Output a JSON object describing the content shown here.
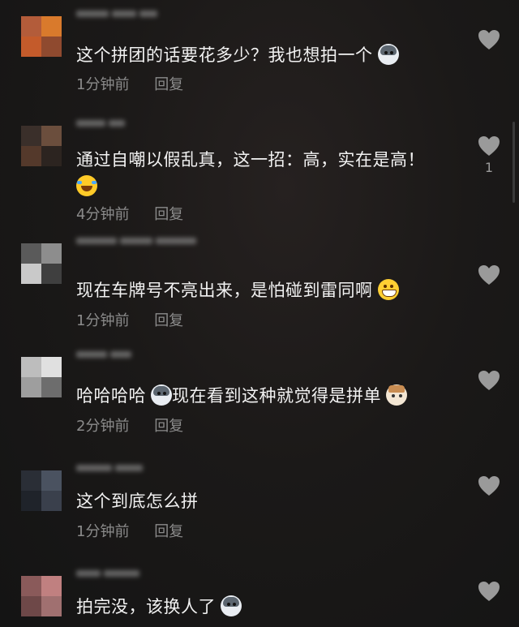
{
  "comments": [
    {
      "text": "这个拼团的话要花多少？我也想拍一个",
      "emoji": "husky-emoji",
      "time": "1分钟前",
      "reply": "回复",
      "likes": "",
      "avatar_colors": [
        "#b35c3a",
        "#d97a2c",
        "#c45b2b",
        "#8f4a2f"
      ]
    },
    {
      "text": "通过自嘲以假乱真，这一招：高，实在是高！",
      "emoji": "laughing-tears-emoji",
      "time": "4分钟前",
      "reply": "回复",
      "likes": "1",
      "avatar_colors": [
        "#3a2f2a",
        "#6b4e3d",
        "#54392b",
        "#2c2420"
      ]
    },
    {
      "text": "现在车牌号不亮出来，是怕碰到雷同啊",
      "emoji": "grin-emoji",
      "time": "1分钟前",
      "reply": "回复",
      "likes": "",
      "avatar_colors": [
        "#5a5a5a",
        "#8d8d8d",
        "#c9c9c9",
        "#3f3f3f"
      ]
    },
    {
      "text": "哈哈哈哈",
      "emoji": "husky-emoji",
      "text2": "现在看到这种就觉得是拼单",
      "emoji2": "cat-emoji",
      "time": "2分钟前",
      "reply": "回复",
      "likes": "",
      "avatar_colors": [
        "#bdbdbd",
        "#e0e0e0",
        "#9e9e9e",
        "#6d6d6d"
      ]
    },
    {
      "text": "这个到底怎么拼",
      "emoji": "",
      "time": "1分钟前",
      "reply": "回复",
      "likes": "",
      "avatar_colors": [
        "#2a2e36",
        "#4a5260",
        "#1f232a",
        "#3a404c"
      ]
    },
    {
      "text": "拍完没，该换人了",
      "emoji": "husky-emoji",
      "time": "",
      "reply": "",
      "likes": "",
      "avatar_colors": [
        "#8a5a5a",
        "#c08080",
        "#6e4848",
        "#a07070"
      ]
    }
  ],
  "icons": {
    "like": "heart-icon"
  },
  "colors": {
    "background": "#161616",
    "text": "#f2f2f2",
    "meta": "#8b8b8b",
    "heart": "#9a9a9a"
  }
}
